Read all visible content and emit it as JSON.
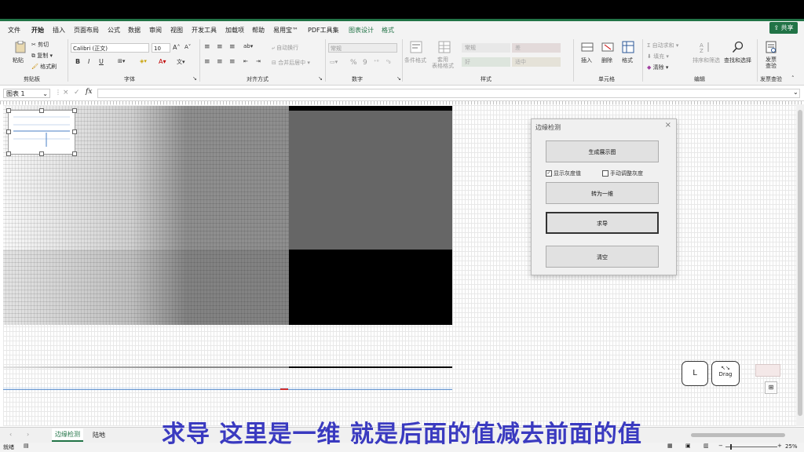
{
  "menu": {
    "tabs": [
      "文件",
      "开始",
      "插入",
      "页面布局",
      "公式",
      "数据",
      "审阅",
      "视图",
      "开发工具",
      "加载项",
      "帮助",
      "易用宝™",
      "PDF工具集",
      "图表设计",
      "格式"
    ],
    "active_index": 1,
    "context_indices": [
      13,
      14
    ],
    "share_label": "共享"
  },
  "ribbon": {
    "clipboard": {
      "paste": "粘贴",
      "cut": "剪切",
      "copy": "复制",
      "format_painter": "格式刷",
      "label": "剪贴板"
    },
    "font": {
      "font_name": "Calibri (正文)",
      "font_size": "10",
      "bold": "B",
      "italic": "I",
      "underline": "U",
      "label": "字体"
    },
    "alignment": {
      "wrap_text": "自动换行",
      "merge_center": "合并后居中",
      "label": "对齐方式"
    },
    "number": {
      "format": "常规",
      "percent": "%",
      "comma": "9",
      "label": "数字"
    },
    "styles": {
      "conditional": "条件格式",
      "table": "套用\n表格格式",
      "cells": [
        "常规",
        "差",
        "好",
        "适中"
      ],
      "label": "样式"
    },
    "cells": {
      "insert": "插入",
      "delete": "删除",
      "format": "格式",
      "label": "单元格"
    },
    "editing": {
      "autosum": "自动求和",
      "fill": "填充",
      "clear": "清除",
      "sort_filter": "排序和筛选",
      "find_select": "查找和选择",
      "label": "编辑"
    },
    "invoice": {
      "check": "发票\n查验",
      "label": "发票查验"
    }
  },
  "formula_bar": {
    "name_box": "图表 1",
    "fx": "fx"
  },
  "dialog": {
    "title": "边缘检测",
    "close": "×",
    "buttons": [
      "生成展示图",
      "转为一维",
      "求导",
      "清空"
    ],
    "checkbox_show_gray": "显示灰度值",
    "checkbox_manual_gray": "手动调整灰度",
    "show_gray_checked": true,
    "manual_gray_checked": false
  },
  "overlay": {
    "l_button": "L",
    "drag_button": "Drag"
  },
  "sheets": {
    "tabs": [
      "边缘检测",
      "陆地"
    ],
    "active": "边缘检测"
  },
  "status": {
    "ready": "就绪",
    "zoom": "25%"
  },
  "subtitle": "求导 这里是一维   就是后面的值减去前面的值"
}
